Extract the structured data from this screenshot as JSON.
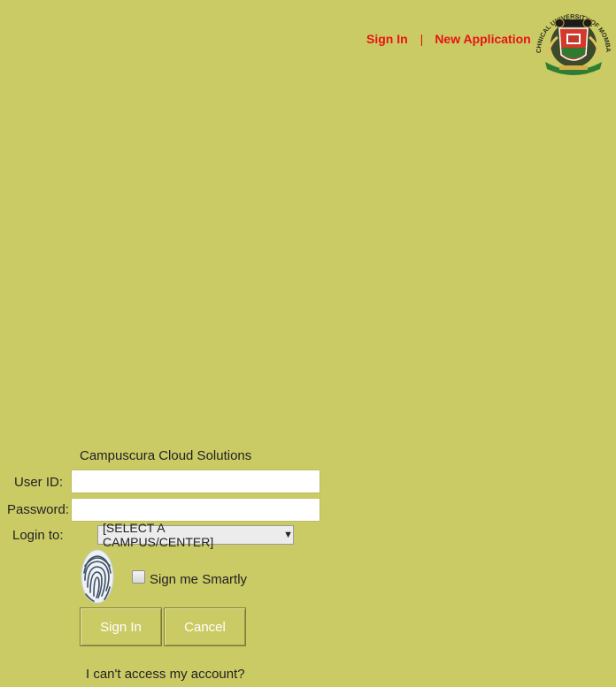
{
  "nav": {
    "sign_in": "Sign In",
    "separator": "|",
    "new_application": "New Application"
  },
  "logo": {
    "icon": "university-seal-logo",
    "text_top": "TECHNICAL UNIVERSITY OF MOMBASA"
  },
  "login": {
    "company": "Campuscura Cloud Solutions",
    "user_id_label": "User ID:",
    "user_id_value": "",
    "password_label": "Password:",
    "password_value": "",
    "login_to_label": "Login to:",
    "campus_selected": "[SELECT A CAMPUS/CENTER]",
    "smart_sign_label": "Sign me Smartly",
    "sign_in_button": "Sign In",
    "cancel_button": "Cancel",
    "access_link": "I can't access my account?"
  },
  "colors": {
    "background": "#cbcb65",
    "nav_link": "#e81212",
    "button_text": "#ffffff"
  }
}
